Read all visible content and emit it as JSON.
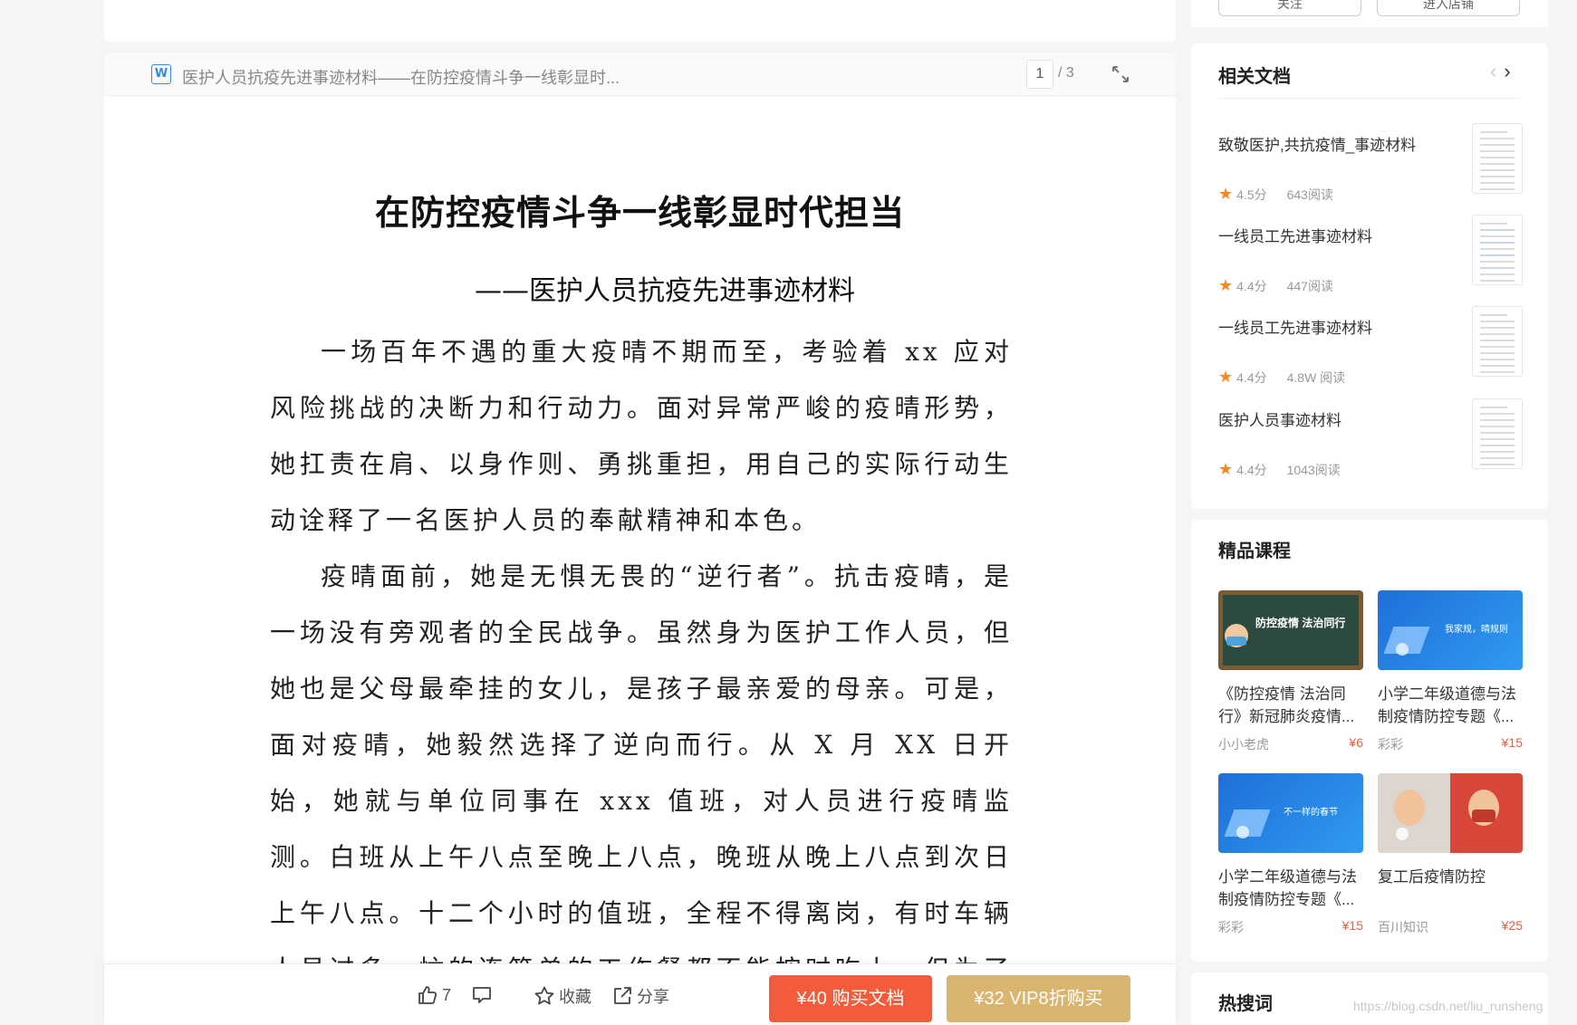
{
  "doc": {
    "file_icon": "W",
    "header_title": "医护人员抗疫先进事迹材料——在防控疫情斗争一线彰显时...",
    "current_page": "1",
    "total_pages": "/ 3",
    "title": "在防控疫情斗争一线彰显时代担当",
    "subtitle": "——医护人员抗疫先进事迹材料",
    "paragraphs": [
      "一场百年不遇的重大疫晴不期而至，考验着 xx 应对风险挑战的决断力和行动力。面对异常严峻的疫晴形势，她扛责在肩、以身作则、勇挑重担，用自己的实际行动生动诠释了一名医护人员的奉献精神和本色。",
      "疫晴面前，她是无惧无畏的“逆行者”。抗击疫晴，是一场没有旁观者的全民战争。虽然身为医护工作人员，但她也是父母最牵挂的女儿，是孩子最亲爱的母亲。可是，面对疫晴，她毅然选择了逆向而行。从 X 月 XX 日开始，她就与单位同事在 xxx 值班，对人员进行疫晴监测。白班从上午八点至晚上八点，晚班从晚上八点到次日上午八点。十二个小时的值班，全程不得离岗，有时车辆人员过多，忙的连简单的工作餐都不能按时吃上，但为了群众的生命安全，她毅然决"
    ]
  },
  "actions": {
    "like_count": "7",
    "collect_label": "收藏",
    "share_label": "分享",
    "buy_label": "¥40 购买文档",
    "vip_label": "¥32 VIP8折购买"
  },
  "right_top": {
    "btn_left": "关注",
    "btn_right": "进入店铺"
  },
  "related": {
    "title": "相关文档",
    "items": [
      {
        "title": "致敬医护,共抗疫情_事迹材料",
        "rating": "4.5分",
        "reads": "643阅读"
      },
      {
        "title": "一线员工先进事迹材料",
        "rating": "4.4分",
        "reads": "447阅读"
      },
      {
        "title": "一线员工先进事迹材料",
        "rating": "4.4分",
        "reads": "4.8W 阅读"
      },
      {
        "title": "医护人员事迹材料",
        "rating": "4.4分",
        "reads": "1043阅读"
      }
    ]
  },
  "courses": {
    "title": "精品课程",
    "items": [
      {
        "name": "《防控疫情 法治同行》新冠肺炎疫情...",
        "author": "小小老虎",
        "price": "¥6",
        "thumb_text": "防控疫情  法治同行"
      },
      {
        "name": "小学二年级道德与法制疫情防控专题《...",
        "author": "彩彩",
        "price": "¥15",
        "thumb_text": "我家规，晴规则"
      },
      {
        "name": "小学二年级道德与法制疫情防控专题《...",
        "author": "彩彩",
        "price": "¥15",
        "thumb_text": "不一样的春节"
      },
      {
        "name": "复工后疫情防控",
        "author": "百川知识",
        "price": "¥25",
        "thumb_text": ""
      }
    ]
  },
  "hot": {
    "title": "热搜词"
  },
  "watermark": "https://blog.csdn.net/liu_runsheng",
  "colors": {
    "buy": "#f25c3a",
    "vip": "#d9b570",
    "star": "#f68a1e",
    "word_blue": "#2f8be6"
  }
}
